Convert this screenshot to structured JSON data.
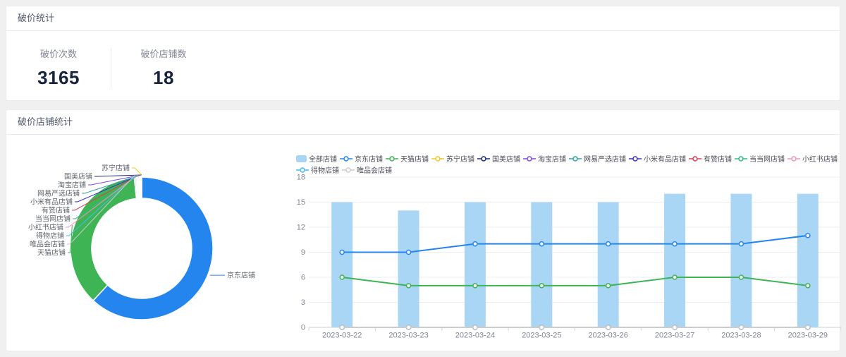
{
  "stats_card": {
    "title": "破价统计",
    "stats": [
      {
        "label": "破价次数",
        "value": "3165"
      },
      {
        "label": "破价店铺数",
        "value": "18"
      }
    ]
  },
  "shops_card": {
    "title": "破价店铺统计"
  },
  "colors": {
    "page_background": "#f0f0f0",
    "card_background": "#ffffff",
    "header_text": "#515a6e",
    "stat_label": "#808695",
    "stat_value": "#17233d",
    "axis_text": "#808695",
    "grid_line": "#ebedf0",
    "axis_line": "#ccd3da",
    "donut_label": "#60666e"
  },
  "chart_data": [
    {
      "type": "pie",
      "donut": true,
      "total": 3165,
      "slices": [
        {
          "name": "京东店铺",
          "value": 1960,
          "color": "#2585ee"
        },
        {
          "name": "天猫店铺",
          "value": 1152,
          "color": "#3eb455"
        },
        {
          "name": "唯品会店铺",
          "value": 11,
          "color": "#cccccc"
        },
        {
          "name": "得物店铺",
          "value": 9,
          "color": "#45bbf2"
        },
        {
          "name": "小红书店铺",
          "value": 7,
          "color": "#f093b8"
        },
        {
          "name": "当当网店铺",
          "value": 6,
          "color": "#2ebd7f"
        },
        {
          "name": "有赞店铺",
          "value": 5,
          "color": "#dc3e52"
        },
        {
          "name": "小米有品店铺",
          "value": 5,
          "color": "#3431c8"
        },
        {
          "name": "网易严选店铺",
          "value": 4,
          "color": "#2ba69e"
        },
        {
          "name": "淘宝店铺",
          "value": 4,
          "color": "#7a48e8"
        },
        {
          "name": "国美店铺",
          "value": 1,
          "color": "#1b2b77"
        },
        {
          "name": "苏宁店铺",
          "value": 1,
          "color": "#f5c522"
        }
      ],
      "legend_position": "none",
      "labels": "outside-with-leader-lines"
    },
    {
      "type": "bar",
      "subtype": "bar-line-combo",
      "categories": [
        "2023-03-22",
        "2023-03-23",
        "2023-03-24",
        "2023-03-25",
        "2023-03-26",
        "2023-03-27",
        "2023-03-28",
        "2023-03-29"
      ],
      "series": [
        {
          "name": "全部店铺",
          "type": "bar",
          "color": "#a9d6f5",
          "values": [
            15,
            14,
            15,
            15,
            15,
            16,
            16,
            16
          ]
        },
        {
          "name": "京东店铺",
          "type": "line",
          "color": "#2585ee",
          "values": [
            9,
            9,
            10,
            10,
            10,
            10,
            10,
            11
          ]
        },
        {
          "name": "天猫店铺",
          "type": "line",
          "color": "#3eb455",
          "values": [
            6,
            5,
            5,
            5,
            5,
            6,
            6,
            5
          ]
        },
        {
          "name": "苏宁店铺",
          "type": "line",
          "color": "#f5c522",
          "values": [
            0,
            0,
            0,
            0,
            0,
            0,
            0,
            0
          ]
        },
        {
          "name": "国美店铺",
          "type": "line",
          "color": "#1b2b77",
          "values": [
            0,
            0,
            0,
            0,
            0,
            0,
            0,
            0
          ]
        },
        {
          "name": "淘宝店铺",
          "type": "line",
          "color": "#7a48e8",
          "values": [
            0,
            0,
            0,
            0,
            0,
            0,
            0,
            0
          ]
        },
        {
          "name": "网易严选店铺",
          "type": "line",
          "color": "#2ba69e",
          "values": [
            0,
            0,
            0,
            0,
            0,
            0,
            0,
            0
          ]
        },
        {
          "name": "小米有品店铺",
          "type": "line",
          "color": "#3431c8",
          "values": [
            0,
            0,
            0,
            0,
            0,
            0,
            0,
            0
          ]
        },
        {
          "name": "有赞店铺",
          "type": "line",
          "color": "#dc3e52",
          "values": [
            0,
            0,
            0,
            0,
            0,
            0,
            0,
            0
          ]
        },
        {
          "name": "当当网店铺",
          "type": "line",
          "color": "#2ebd7f",
          "values": [
            0,
            0,
            0,
            0,
            0,
            0,
            0,
            0
          ]
        },
        {
          "name": "小红书店铺",
          "type": "line",
          "color": "#f093b8",
          "values": [
            0,
            0,
            0,
            0,
            0,
            0,
            0,
            0
          ]
        },
        {
          "name": "得物店铺",
          "type": "line",
          "color": "#45bbf2",
          "values": [
            0,
            0,
            0,
            0,
            0,
            0,
            0,
            0
          ]
        },
        {
          "name": "唯品会店铺",
          "type": "line",
          "color": "#cccccc",
          "values": [
            0,
            0,
            0,
            0,
            0,
            0,
            0,
            0
          ]
        }
      ],
      "ylim": [
        0,
        18
      ],
      "yticks": [
        0,
        3,
        6,
        9,
        12,
        15,
        18
      ],
      "grid": true,
      "legend_position": "top"
    }
  ]
}
